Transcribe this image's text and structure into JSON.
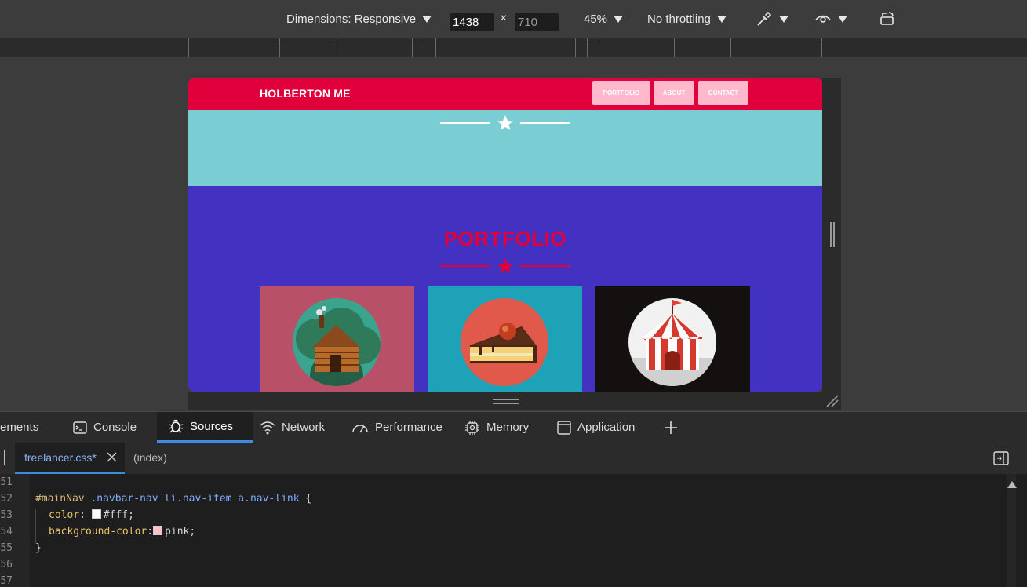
{
  "device_toolbar": {
    "dimensions_label": "Dimensions: Responsive",
    "width_value": "1438",
    "times": "×",
    "height_placeholder": "710",
    "zoom": "45%",
    "throttling": "No throttling",
    "icons": [
      "eyedropper-icon",
      "eye-icon",
      "rotate-icon"
    ]
  },
  "site": {
    "brand": "HOLBERTON ME",
    "nav": [
      "PORTFOLIO",
      "ABOUT",
      "CONTACT"
    ],
    "section_title": "PORTFOLIO",
    "colors": {
      "primary": "#e0003c",
      "hero": "#79cdd3",
      "portfolio_bg": "#4332c2",
      "nav_link_bg": "#ffb8cc"
    },
    "cards": [
      {
        "name": "cabin",
        "bg": "#b85168"
      },
      {
        "name": "cake",
        "bg": "#1ea2b8"
      },
      {
        "name": "circus",
        "bg": "#151010"
      }
    ]
  },
  "devtools": {
    "tabs": [
      "ements",
      "Console",
      "Sources",
      "Network",
      "Performance",
      "Memory",
      "Application"
    ],
    "active_tab": "Sources",
    "files": [
      "freelancer.css*",
      "(index)"
    ],
    "active_file": "freelancer.css*",
    "line_numbers": [
      "51",
      "52",
      "53",
      "54",
      "55",
      "56",
      "57"
    ],
    "code": {
      "sel_id": "#mainNav",
      "sel_rest": ".navbar-nav li.nav-item a.nav-link",
      "brace_open": " {",
      "prop1": "color",
      "val1": "#fff;",
      "prop2": "background-color",
      "val2": "pink;",
      "brace_close": "}"
    }
  }
}
